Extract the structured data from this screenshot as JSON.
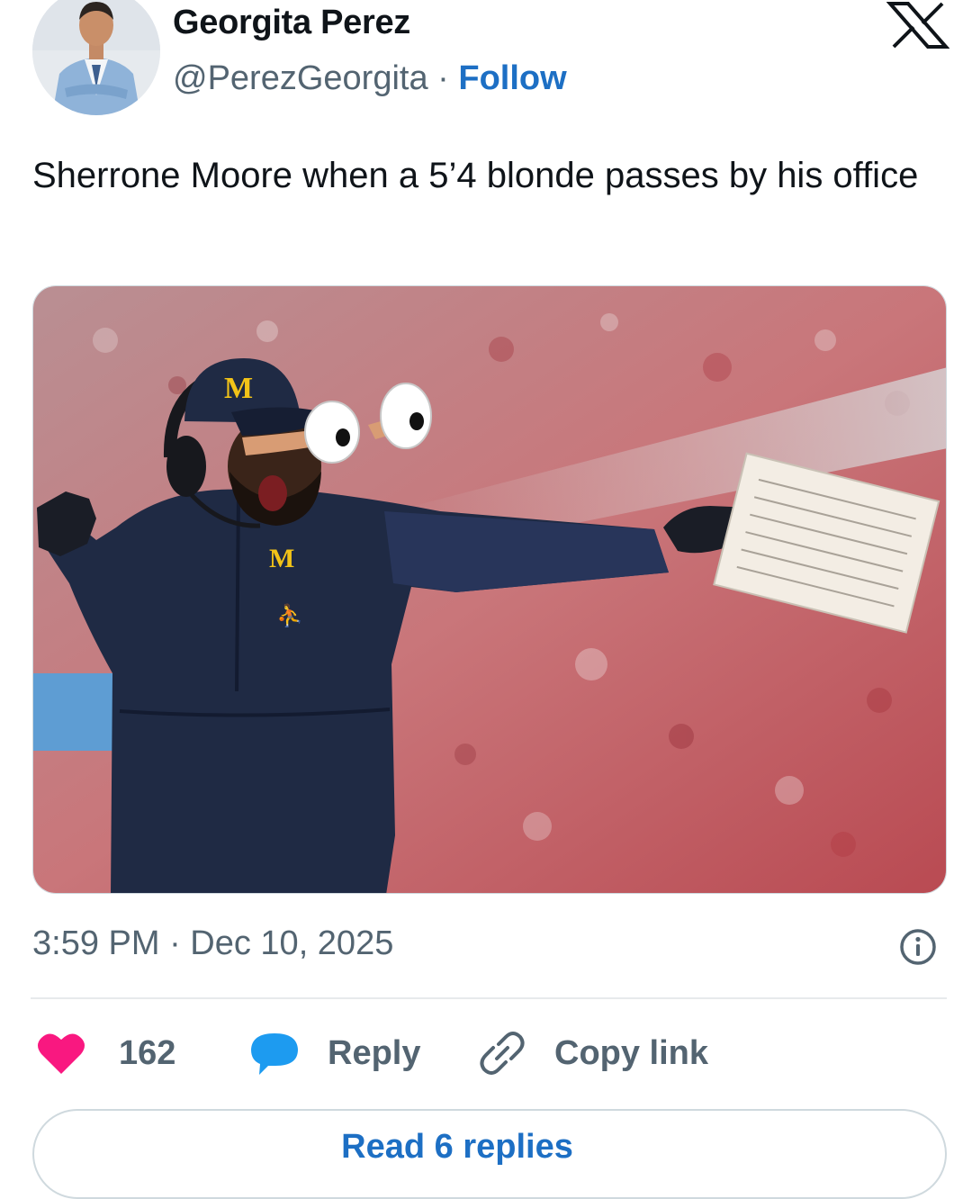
{
  "author": {
    "name": "Georgita Perez",
    "handle": "@PerezGeorgita",
    "separator": "·",
    "follow_label": "Follow"
  },
  "tweet": {
    "text": "Sherrone Moore when a 5’4 blonde passes by his office",
    "timestamp": "3:59 PM · Dec 10, 2025"
  },
  "actions": {
    "like_count": "162",
    "reply_label": "Reply",
    "copy_link_label": "Copy link"
  },
  "replies_button": "Read 6 replies",
  "icons": {
    "brand": "x-logo-icon",
    "info": "info-icon",
    "like": "heart-icon",
    "reply": "speech-bubble-icon",
    "copy": "link-icon"
  },
  "colors": {
    "link_blue": "#1d6fc4",
    "heart_pink": "#f91880",
    "reply_blue": "#1d9bf0",
    "muted_text": "#536471"
  }
}
